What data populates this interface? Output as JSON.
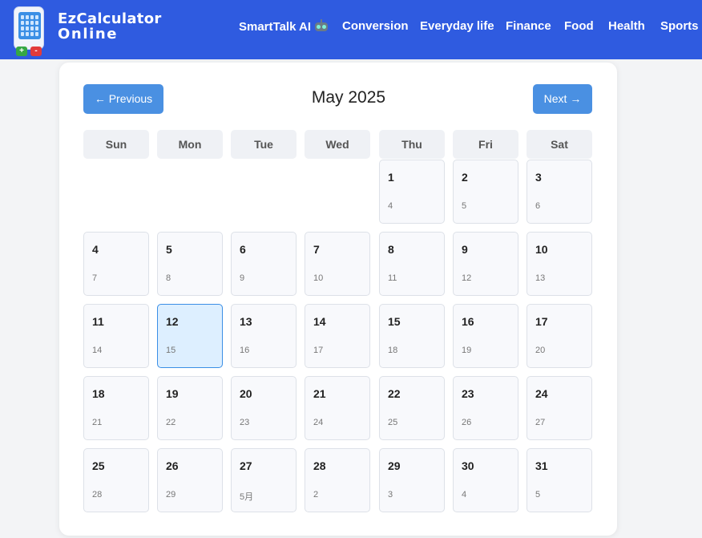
{
  "brand": {
    "line1": "EzCalculator",
    "line2": "Online"
  },
  "logo": {
    "plus": "+",
    "minus": "-"
  },
  "nav": [
    "SmartTalk AI",
    "Conversion",
    "Everyday life",
    "Finance",
    "Food",
    "Health",
    "Sports"
  ],
  "calendar": {
    "title": "May 2025",
    "prev": "← Previous",
    "next": "Next →",
    "weekdays": [
      "Sun",
      "Mon",
      "Tue",
      "Wed",
      "Thu",
      "Fri",
      "Sat"
    ],
    "selected": "12",
    "days": [
      {
        "d": "1",
        "l": "4"
      },
      {
        "d": "2",
        "l": "5"
      },
      {
        "d": "3",
        "l": "6"
      },
      {
        "d": "4",
        "l": "7"
      },
      {
        "d": "5",
        "l": "8"
      },
      {
        "d": "6",
        "l": "9"
      },
      {
        "d": "7",
        "l": "10"
      },
      {
        "d": "8",
        "l": "11"
      },
      {
        "d": "9",
        "l": "12"
      },
      {
        "d": "10",
        "l": "13"
      },
      {
        "d": "11",
        "l": "14"
      },
      {
        "d": "12",
        "l": "15"
      },
      {
        "d": "13",
        "l": "16"
      },
      {
        "d": "14",
        "l": "17"
      },
      {
        "d": "15",
        "l": "18"
      },
      {
        "d": "16",
        "l": "19"
      },
      {
        "d": "17",
        "l": "20"
      },
      {
        "d": "18",
        "l": "21"
      },
      {
        "d": "19",
        "l": "22"
      },
      {
        "d": "20",
        "l": "23"
      },
      {
        "d": "21",
        "l": "24"
      },
      {
        "d": "22",
        "l": "25"
      },
      {
        "d": "23",
        "l": "26"
      },
      {
        "d": "24",
        "l": "27"
      },
      {
        "d": "25",
        "l": "28"
      },
      {
        "d": "26",
        "l": "29"
      },
      {
        "d": "27",
        "l": "5月"
      },
      {
        "d": "28",
        "l": "2"
      },
      {
        "d": "29",
        "l": "3"
      },
      {
        "d": "30",
        "l": "4"
      },
      {
        "d": "31",
        "l": "5"
      }
    ]
  }
}
